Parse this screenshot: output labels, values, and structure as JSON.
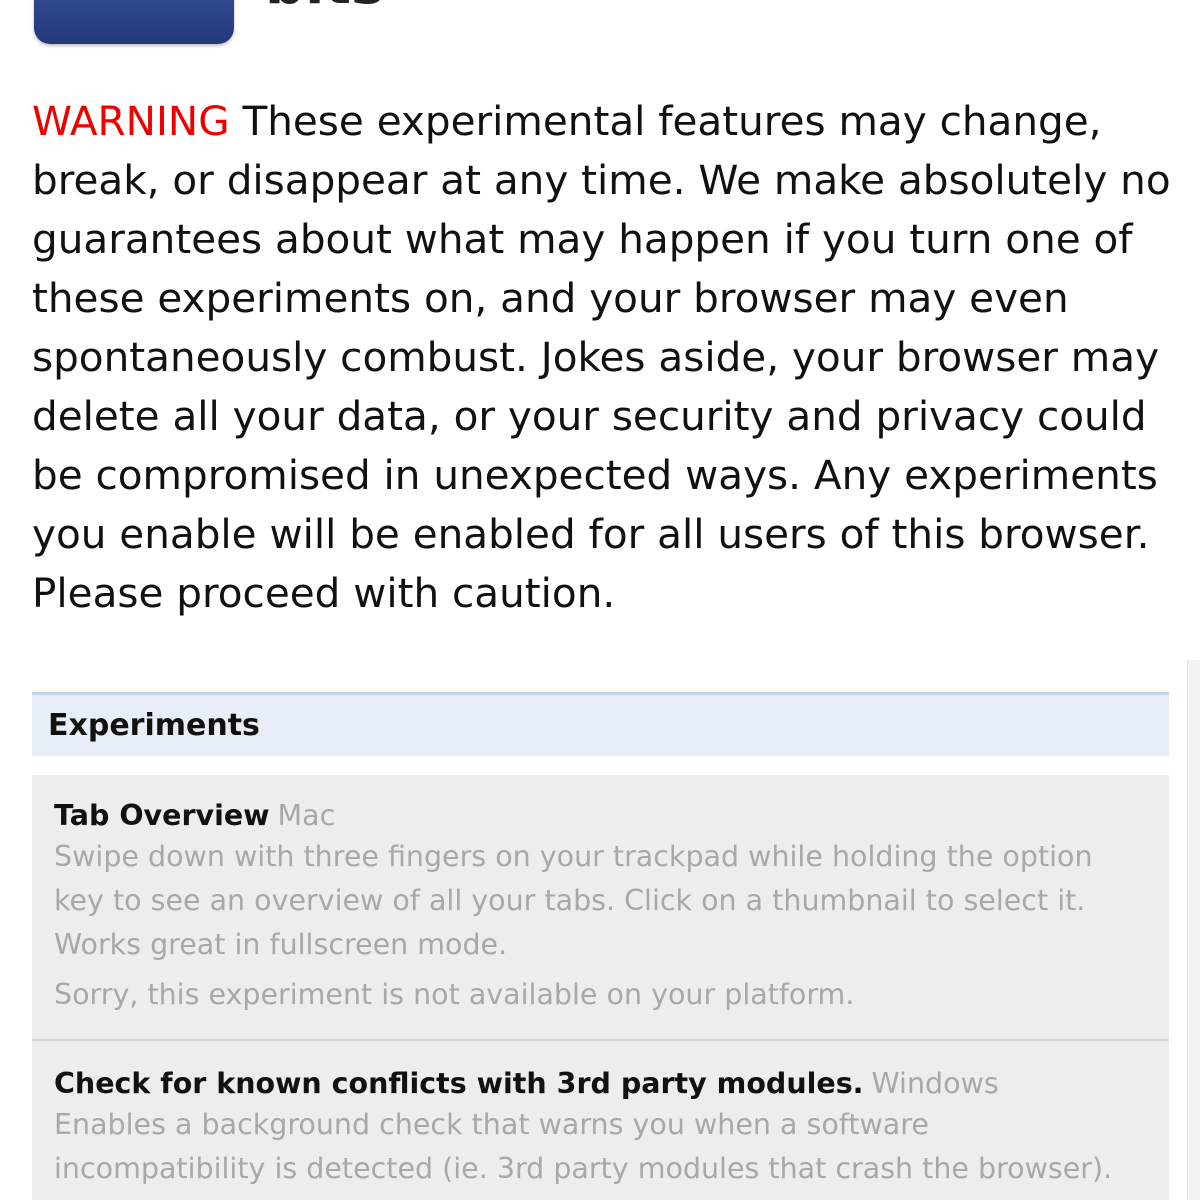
{
  "header": {
    "title": "bits"
  },
  "warning": {
    "label": "WARNING",
    "text": "These experimental features may change, break, or disappear at any time. We make absolutely no guarantees about what may happen if you turn one of these experiments on, and your browser may even spontaneously combust. Jokes aside, your browser may delete all your data, or your security and privacy could be compromised in unexpected ways. Any experiments you enable will be enabled for all users of this browser. Please proceed with caution."
  },
  "experiments": {
    "section_title": "Experiments",
    "items": [
      {
        "name": "Tab Overview",
        "platform": "Mac",
        "description": "Swipe down with three fingers on your trackpad while holding the option key to see an overview of all your tabs. Click on a thumbnail to select it. Works great in fullscreen mode.",
        "note": "Sorry, this experiment is not available on your platform."
      },
      {
        "name": "Check for known conflicts with 3rd party modules.",
        "platform": "Windows",
        "description": "Enables a background check that warns you when a software incompatibility is detected (ie. 3rd party modules that crash the browser)."
      }
    ]
  },
  "icons": {
    "app_icon": "app-logo-icon"
  },
  "colors": {
    "warning": "#ee0000",
    "section_header_bg": "#e8eef8",
    "experiment_bg": "#ededed",
    "muted_text": "#a8a8a8"
  }
}
